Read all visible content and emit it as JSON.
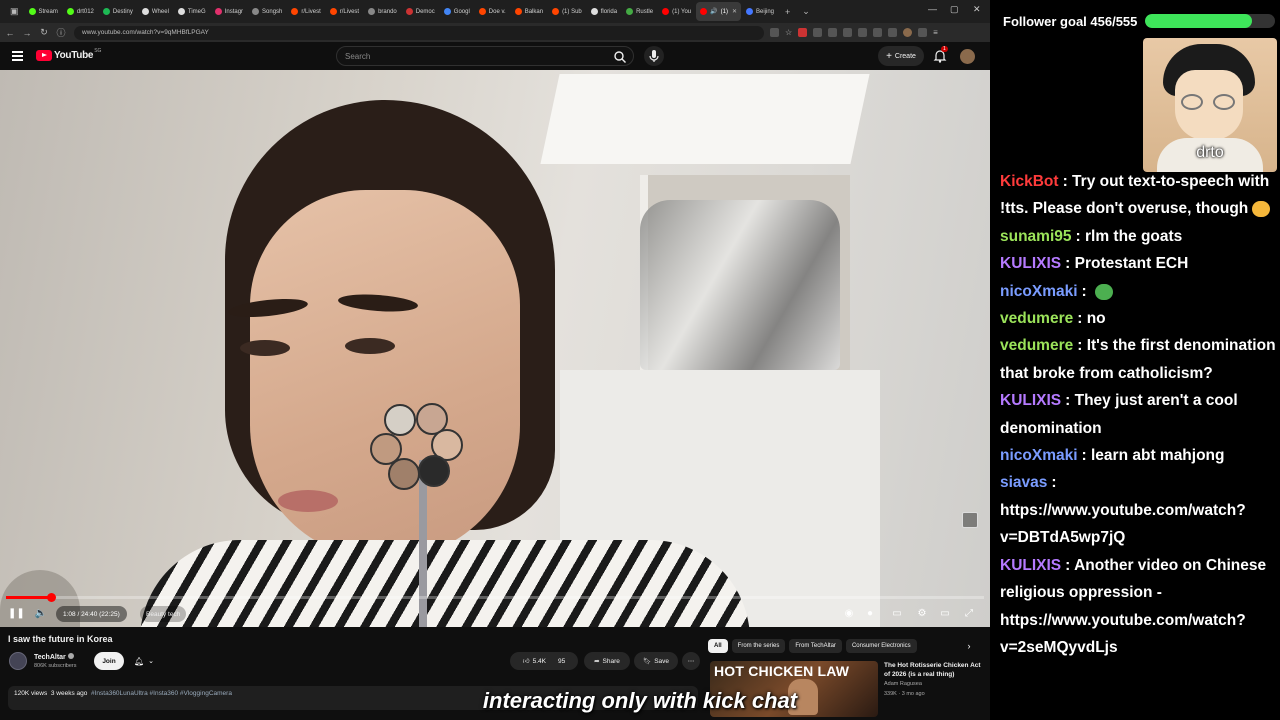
{
  "browser": {
    "tabs": [
      {
        "label": "Stream",
        "color": "#53fc18"
      },
      {
        "label": "drt012",
        "color": "#53fc18"
      },
      {
        "label": "Destiny",
        "color": "#1db954"
      },
      {
        "label": "Wheel",
        "color": "#dddddd"
      },
      {
        "label": "TimeG",
        "color": "#dddddd"
      },
      {
        "label": "Instagr",
        "color": "#e1306c"
      },
      {
        "label": "Songsh",
        "color": "#888888"
      },
      {
        "label": "r/Livest",
        "color": "#ff4500"
      },
      {
        "label": "r/Livest",
        "color": "#ff4500"
      },
      {
        "label": "brando",
        "color": "#888888"
      },
      {
        "label": "Democ",
        "color": "#cc3333"
      },
      {
        "label": "Googl",
        "color": "#4285f4"
      },
      {
        "label": "Doe v.",
        "color": "#ff4500"
      },
      {
        "label": "Balkan",
        "color": "#ff4500"
      },
      {
        "label": "(1) Sub",
        "color": "#ff4500"
      },
      {
        "label": "florida",
        "color": "#dddddd"
      },
      {
        "label": "Rustle",
        "color": "#44aa44"
      },
      {
        "label": "(1) You",
        "color": "#ff0000"
      }
    ],
    "active_tab": {
      "label": "(1)",
      "color": "#ff0000"
    },
    "after_tab": {
      "label": "Beijing",
      "color": "#4477ff"
    },
    "url": "www.youtube.com/watch?v=9qMHBfLPGAY"
  },
  "youtube": {
    "logo": "YouTube",
    "country": "SG",
    "search_placeholder": "Search",
    "create_label": "Create",
    "notif_count": "1"
  },
  "player": {
    "time": "1:08 / 24:40 (22:25)",
    "chapter": "Beauty tech",
    "progress": 0.046
  },
  "video": {
    "title": "I saw the future in Korea",
    "channel": "TechAltar",
    "subscribers": "806K subscribers",
    "join_label": "Join",
    "likes": "5.4K",
    "comments": "95",
    "share_label": "Share",
    "save_label": "Save",
    "views": "120K views",
    "age": "3 weeks ago",
    "tags": "#Insta360LunaUltra #Insta360 #VloggingCamera"
  },
  "related": {
    "chips": [
      "All",
      "From the series",
      "From TechAltar",
      "Consumer Electronics"
    ],
    "thumb_text": "HOT CHICKEN LAW",
    "title": "The Hot Rotisserie Chicken Act of 2026 (is a real thing)",
    "channel": "Adam Ragusea",
    "meta": "339K · 3 mo ago"
  },
  "caption": "interacting only with kick chat",
  "stream": {
    "goal_label": "Follower goal 456/555",
    "goal_current": 456,
    "goal_target": 555,
    "goal_color": "#3ee55a",
    "cam_name": "drto",
    "chat": [
      {
        "user": "KickBot",
        "color": "#ff3b3b",
        "text": "Try out text-to-speech with !tts. Please don't overuse, though",
        "emote": "smile"
      },
      {
        "user": "sunami95",
        "color": "#9be35a",
        "text": "rlm the goats"
      },
      {
        "user": "KULIXIS",
        "color": "#b57aff",
        "text": "Protestant ECH"
      },
      {
        "user": "nicoXmaki",
        "color": "#7a9cff",
        "text": "",
        "emote": "pepe"
      },
      {
        "user": "vedumere",
        "color": "#9be35a",
        "text": "no"
      },
      {
        "user": "vedumere",
        "color": "#9be35a",
        "text": "It's the first denomination that broke from catholicism?"
      },
      {
        "user": "KULIXIS",
        "color": "#b57aff",
        "text": "They just aren't a cool denomination"
      },
      {
        "user": "nicoXmaki",
        "color": "#7a9cff",
        "text": "learn abt mahjong"
      },
      {
        "user": "siavas",
        "color": "#7a9cff",
        "text": "https://www.youtube.com/watch?v=DBTdA5wp7jQ"
      },
      {
        "user": "KULIXIS",
        "color": "#b57aff",
        "text": "Another video on Chinese religious oppression - https://www.youtube.com/watch?v=2seMQyvdLjs"
      }
    ]
  }
}
